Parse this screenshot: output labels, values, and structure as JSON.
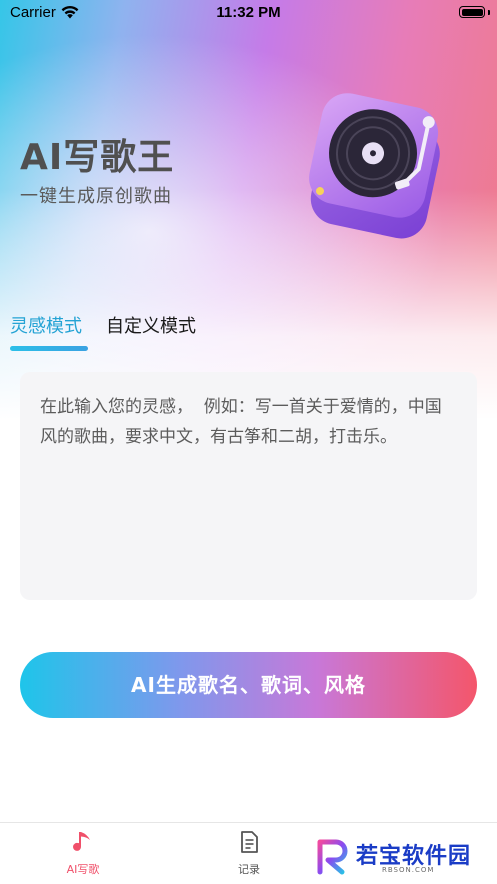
{
  "status_bar": {
    "carrier": "Carrier",
    "time": "11:32 PM",
    "battery_level": 1.0
  },
  "hero": {
    "title": "AI写歌王",
    "subtitle": "一键生成原创歌曲",
    "illustration_icon": "turntable-icon"
  },
  "mode_tabs": {
    "active": "灵感模式",
    "other": "自定义模式"
  },
  "prompt": {
    "placeholder": "在此输入您的灵感，  例如：写一首关于爱情的，中国风的歌曲，要求中文，有古筝和二胡，打击乐。",
    "value": ""
  },
  "generate_button": {
    "label": "AI生成歌名、歌词、风格"
  },
  "tabbar": {
    "items": [
      {
        "label": "AI写歌",
        "icon": "music-note-icon",
        "active": true
      },
      {
        "label": "记录",
        "icon": "document-icon",
        "active": false
      }
    ]
  },
  "watermark": {
    "text": "若宝软件园",
    "subtext": "RBSON.COM"
  },
  "colors": {
    "accent_blue": "#24a3d4",
    "accent_red": "#f0506a",
    "gradient_start": "#1ec5ea",
    "gradient_end": "#f4566b",
    "input_bg": "#f5f5f7"
  }
}
